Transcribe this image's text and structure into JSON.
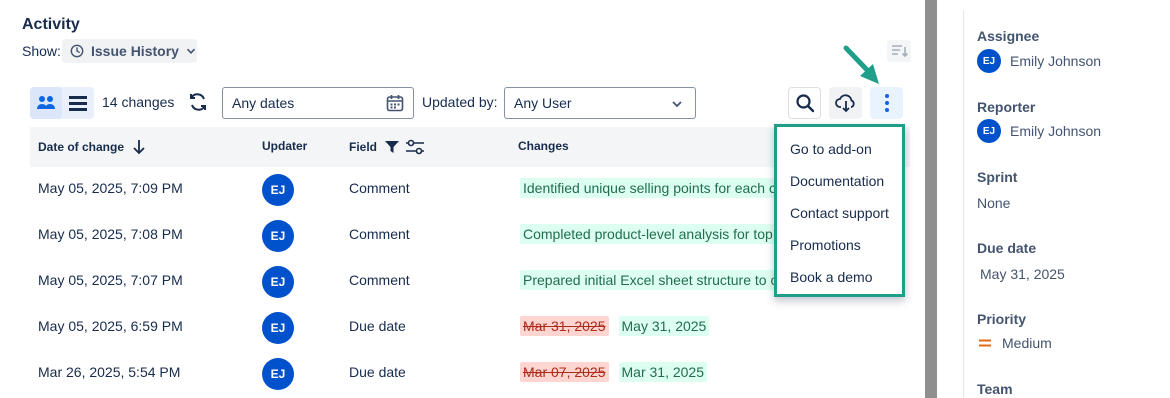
{
  "activity": {
    "title": "Activity",
    "show_label": "Show:",
    "show_value": "Issue History"
  },
  "toolbar": {
    "changes_count": "14 changes",
    "date_filter": "Any dates",
    "updated_by_label": "Updated by:",
    "user_filter": "Any User"
  },
  "table": {
    "columns": {
      "date": "Date of change",
      "updater": "Updater",
      "field": "Field",
      "changes": "Changes"
    },
    "rows": [
      {
        "date": "May 05, 2025, 7:09 PM",
        "initials": "EJ",
        "field": "Comment",
        "removed": "",
        "added": "Identified unique selling points for each c"
      },
      {
        "date": "May 05, 2025, 7:08 PM",
        "initials": "EJ",
        "field": "Comment",
        "removed": "",
        "added": "Completed product-level analysis for top"
      },
      {
        "date": "May 05, 2025, 7:07 PM",
        "initials": "EJ",
        "field": "Comment",
        "removed": "",
        "added": "Prepared initial Excel sheet structure to c"
      },
      {
        "date": "May 05, 2025, 6:59 PM",
        "initials": "EJ",
        "field": "Due date",
        "removed": "Mar 31, 2025",
        "added": "May 31, 2025"
      },
      {
        "date": "Mar 26, 2025, 5:54 PM",
        "initials": "EJ",
        "field": "Due date",
        "removed": "Mar 07, 2025",
        "added": "Mar 31, 2025"
      }
    ]
  },
  "menu": {
    "items": [
      "Go to add-on",
      "Documentation",
      "Contact support",
      "Promotions",
      "Book a demo"
    ]
  },
  "details": {
    "assignee_label": "Assignee",
    "assignee_initials": "EJ",
    "assignee_name": "Emily Johnson",
    "reporter_label": "Reporter",
    "reporter_initials": "EJ",
    "reporter_name": "Emily Johnson",
    "sprint_label": "Sprint",
    "sprint_value": "None",
    "due_label": "Due date",
    "due_value": "May 31, 2025",
    "priority_label": "Priority",
    "priority_value": "Medium",
    "team_label": "Team"
  },
  "colors": {
    "brand": "#0052cc",
    "highlight_border": "#1f9e8a",
    "added_bg": "#dcfff1",
    "removed_bg": "#ffd5d2",
    "priority_medium": "#e56910"
  }
}
